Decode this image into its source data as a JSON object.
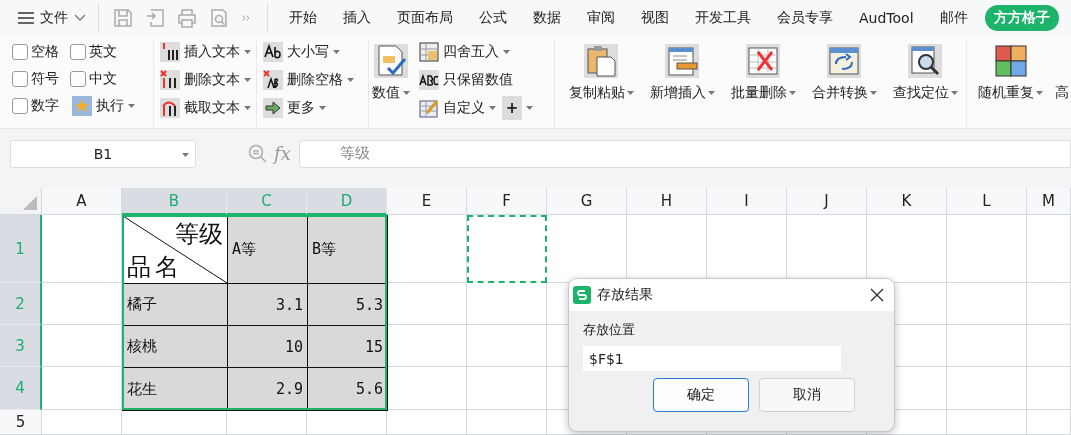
{
  "menu": {
    "label": "文件"
  },
  "tabs": [
    {
      "label": "开始",
      "selected": false
    },
    {
      "label": "插入",
      "selected": false
    },
    {
      "label": "页面布局",
      "selected": false
    },
    {
      "label": "公式",
      "selected": false
    },
    {
      "label": "数据",
      "selected": false
    },
    {
      "label": "审阅",
      "selected": false
    },
    {
      "label": "视图",
      "selected": false
    },
    {
      "label": "开发工具",
      "selected": false
    },
    {
      "label": "会员专享",
      "selected": false
    },
    {
      "label": "AudTool",
      "selected": false
    },
    {
      "label": "邮件",
      "selected": false
    },
    {
      "label": "方方格子",
      "selected": true
    }
  ],
  "ribbon": {
    "checkboxes": [
      {
        "label": "空格",
        "checked": false
      },
      {
        "label": "英文",
        "checked": false
      },
      {
        "label": "符号",
        "checked": false
      },
      {
        "label": "中文",
        "checked": false
      },
      {
        "label": "数字",
        "checked": false
      }
    ],
    "run_button": {
      "label": "执行"
    },
    "text_tools": [
      "插入文本",
      "删除文本",
      "截取文本"
    ],
    "case_tools": [
      "大小写",
      "删除空格",
      "更多"
    ],
    "number_button": {
      "label": "数值"
    },
    "number_tools": [
      "四舍五入",
      "只保留数值",
      "自定义"
    ],
    "plus_button": {
      "label": "+"
    },
    "big_buttons": [
      "复制粘贴",
      "新增插入",
      "批量删除",
      "合并转换",
      "查找定位"
    ],
    "random_button": {
      "label": "随机重复"
    },
    "cut_label": "高"
  },
  "formula_bar": {
    "name_box": "B1",
    "function_label": "fx",
    "formula": "等级"
  },
  "sheet": {
    "columns": [
      {
        "label": "A",
        "selected": false
      },
      {
        "label": "B",
        "selected": true
      },
      {
        "label": "C",
        "selected": true
      },
      {
        "label": "D",
        "selected": true
      },
      {
        "label": "E",
        "selected": false
      },
      {
        "label": "F",
        "selected": false
      },
      {
        "label": "G",
        "selected": false
      },
      {
        "label": "H",
        "selected": false
      },
      {
        "label": "I",
        "selected": false
      },
      {
        "label": "J",
        "selected": false
      },
      {
        "label": "K",
        "selected": false
      },
      {
        "label": "L",
        "selected": false
      },
      {
        "label": "M",
        "selected": false
      }
    ],
    "rows": [
      {
        "label": "1",
        "selected": true
      },
      {
        "label": "2",
        "selected": true
      },
      {
        "label": "3",
        "selected": true
      },
      {
        "label": "4",
        "selected": true
      },
      {
        "label": "5",
        "selected": false
      }
    ],
    "table": {
      "corner_top": "等级",
      "corner_bottom": "品名",
      "headers": [
        "A等",
        "B等"
      ],
      "rows": [
        {
          "name": "橘子",
          "values": [
            "3.1",
            "5.3"
          ]
        },
        {
          "name": "核桃",
          "values": [
            "10",
            "15"
          ]
        },
        {
          "name": "花生",
          "values": [
            "2.9",
            "5.6"
          ]
        }
      ]
    }
  },
  "dialog": {
    "title": "存放结果",
    "field_label": "存放位置",
    "value": "$F$1",
    "buttons": [
      {
        "label": "确定",
        "primary": true
      },
      {
        "label": "取消",
        "primary": false
      }
    ]
  }
}
